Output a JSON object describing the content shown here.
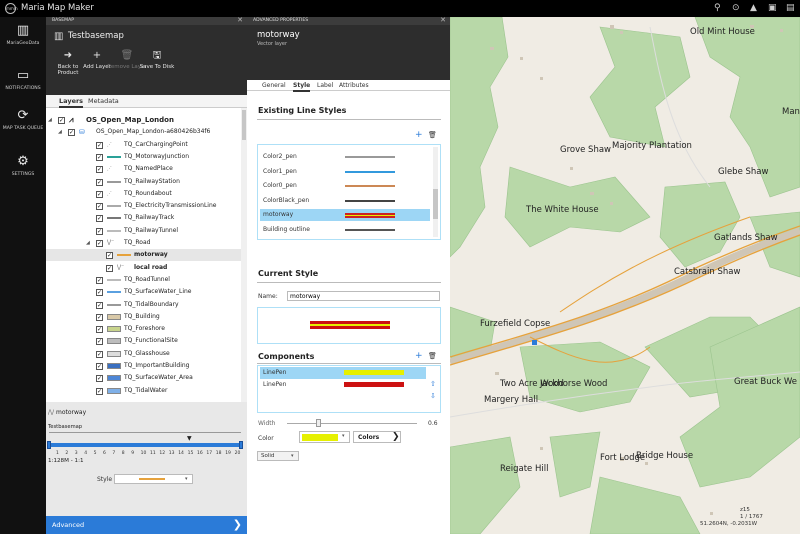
{
  "app": {
    "title": "Maria Map Maker",
    "logo_text": "mmm"
  },
  "nav": [
    {
      "label": "MariaGeoData",
      "icon": "map-icon"
    },
    {
      "label": "NOTIFICATIONS",
      "icon": "notification-icon"
    },
    {
      "label": "MAP TASK QUEUE",
      "icon": "sync-icon"
    },
    {
      "label": "SETTINGS",
      "icon": "gear-icon"
    }
  ],
  "basemap_panel": {
    "header": "BASEMAP",
    "title": "Testbasemap",
    "toolbar": [
      {
        "label": "Back to Product",
        "icon": "back-arrow-icon",
        "enabled": true
      },
      {
        "label": "Add Layer",
        "icon": "plus-icon",
        "enabled": true
      },
      {
        "label": "Remove Layer",
        "icon": "trash-icon",
        "enabled": false
      },
      {
        "label": "Save To Disk",
        "icon": "save-icon",
        "enabled": true
      }
    ],
    "tabs": [
      "Layers",
      "Metadata"
    ],
    "tree": [
      {
        "label": "OS_Open_Map_London",
        "level": 0,
        "checked": true,
        "bold": true,
        "symbol": "polyline-icon",
        "expand": "collapse"
      },
      {
        "label": "OS_Open_Map_London-a680426b34f6",
        "level": 1,
        "checked": true,
        "bold": false,
        "symbol": "database-icon",
        "expand": "collapse"
      },
      {
        "label": "TQ_CarChargingPoint",
        "level": 2,
        "checked": true,
        "symbol": "point-dots",
        "color": "#555555"
      },
      {
        "label": "TQ_MotorwayJunction",
        "level": 2,
        "checked": true,
        "symbol": "line",
        "color": "#2aa198"
      },
      {
        "label": "TQ_NamedPlace",
        "level": 2,
        "checked": true,
        "symbol": "point-dots",
        "color": "#555555"
      },
      {
        "label": "TQ_RailwayStation",
        "level": 2,
        "checked": true,
        "symbol": "line",
        "color": "#999999"
      },
      {
        "label": "TQ_Roundabout",
        "level": 2,
        "checked": true,
        "symbol": "point-dots",
        "color": "#555555"
      },
      {
        "label": "TQ_ElectricityTransmissionLine",
        "level": 2,
        "checked": true,
        "symbol": "line",
        "color": "#aaaaaa"
      },
      {
        "label": "TQ_RailwayTrack",
        "level": 2,
        "checked": true,
        "symbol": "line",
        "color": "#777777"
      },
      {
        "label": "TQ_RailwayTunnel",
        "level": 2,
        "checked": true,
        "symbol": "line",
        "color": "#bbbbbb"
      },
      {
        "label": "TQ_Road",
        "level": 2,
        "checked": true,
        "symbol": "road-icon",
        "expand": "collapse"
      },
      {
        "label": "motorway",
        "level": 3,
        "checked": true,
        "bold": true,
        "symbol": "line",
        "color": "#e6a23c",
        "selected": true
      },
      {
        "label": "local road",
        "level": 3,
        "checked": true,
        "bold": true,
        "symbol": "road-icon"
      },
      {
        "label": "TQ_RoadTunnel",
        "level": 2,
        "checked": true,
        "symbol": "line",
        "color": "#bbbbbb"
      },
      {
        "label": "TQ_SurfaceWater_Line",
        "level": 2,
        "checked": true,
        "symbol": "line",
        "color": "#5aa0e0"
      },
      {
        "label": "TQ_TidalBoundary",
        "level": 2,
        "checked": true,
        "symbol": "line",
        "color": "#999999"
      },
      {
        "label": "TQ_Building",
        "level": 2,
        "checked": true,
        "symbol": "fill",
        "color": "#d9c9a8"
      },
      {
        "label": "TQ_Foreshore",
        "level": 2,
        "checked": true,
        "symbol": "fill",
        "color": "#c8d48c"
      },
      {
        "label": "TQ_FunctionalSite",
        "level": 2,
        "checked": true,
        "symbol": "fill",
        "color": "#bdbdbd"
      },
      {
        "label": "TQ_Glasshouse",
        "level": 2,
        "checked": true,
        "symbol": "fill",
        "color": "#dddddd"
      },
      {
        "label": "TQ_ImportantBuilding",
        "level": 2,
        "checked": true,
        "symbol": "fill",
        "color": "#3a6fc0"
      },
      {
        "label": "TQ_SurfaceWater_Area",
        "level": 2,
        "checked": true,
        "symbol": "fill",
        "color": "#4d86d6"
      },
      {
        "label": "TQ_TidalWater",
        "level": 2,
        "checked": true,
        "symbol": "fill",
        "color": "#7fb0e8"
      }
    ],
    "style_box": {
      "layer_name": "motorway",
      "basemap_label": "Testbasemap",
      "scale_ticks": [
        "1",
        "2",
        "3",
        "4",
        "5",
        "6",
        "7",
        "8",
        "9",
        "10",
        "11",
        "12",
        "13",
        "14",
        "15",
        "16",
        "17",
        "18",
        "19",
        "20"
      ],
      "scale_label": "1:128M - 1:1",
      "style_label": "Style"
    },
    "advanced_label": "Advanced"
  },
  "advanced_panel": {
    "header": "ADVANCED PROPERTIES",
    "title": "motorway",
    "subtitle": "Vector layer",
    "tabs": [
      "General",
      "Style",
      "Label",
      "Attributes"
    ],
    "active_tab": "Style",
    "existing_title": "Existing Line Styles",
    "existing_styles": [
      {
        "name": "Color2_pen",
        "color": "#999999",
        "selected": false
      },
      {
        "name": "Color1_pen",
        "color": "#3399dd",
        "selected": false
      },
      {
        "name": "Color0_pen",
        "color": "#cc8855",
        "selected": false
      },
      {
        "name": "ColorBlack_pen",
        "color": "#444444",
        "selected": false
      },
      {
        "name": "motorway",
        "color": "#cc2222",
        "selected": true
      },
      {
        "name": "Building outline",
        "color": "#555555",
        "selected": false
      }
    ],
    "current_title": "Current Style",
    "name_label": "Name:",
    "name_value": "motorway",
    "components_title": "Components",
    "components": [
      {
        "name": "LinePen",
        "color": "#e6f000",
        "selected": true
      },
      {
        "name": "LinePen",
        "color": "#cc1111",
        "selected": false
      }
    ],
    "width_label": "Width",
    "width_value": "0.6",
    "color_label": "Color",
    "colors_button": "Colors",
    "dash_value": "Solid",
    "accent": "#2b7bd8"
  },
  "map": {
    "labels": [
      {
        "text": "Old Mint House"
      },
      {
        "text": "Mansh"
      },
      {
        "text": "Grove Shaw"
      },
      {
        "text": "Majority Plantation"
      },
      {
        "text": "Glebe Shaw"
      },
      {
        "text": "The White House"
      },
      {
        "text": "Gatlands Shaw"
      },
      {
        "text": "Catsbrain Shaw"
      },
      {
        "text": "Furzefield Copse"
      },
      {
        "text": "Two Acre Wood"
      },
      {
        "text": "Jackhorse Wood"
      },
      {
        "text": "Great Buck We"
      },
      {
        "text": "Margery Hall"
      },
      {
        "text": "Fort Lodge"
      },
      {
        "text": "Bridge House"
      },
      {
        "text": "Reigate Hill"
      }
    ],
    "zoom": "z15",
    "coord1": "1 / 1767",
    "coord2": "51.2604N, -0.2031W"
  }
}
